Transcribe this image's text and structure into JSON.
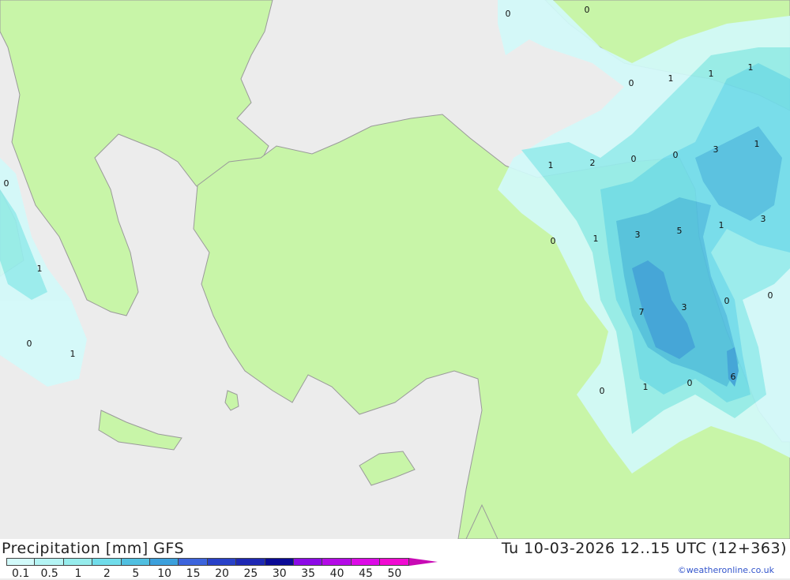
{
  "title": "Precipitation [mm] GFS",
  "valid_time": "Tu 10-03-2026 12..15 UTC (12+363)",
  "credit": "©weatheronline.co.uk",
  "colors": {
    "land": "#c8f5a8",
    "sea": "#ececec",
    "border": "#999999"
  },
  "legend": {
    "labels": [
      "0.1",
      "0.5",
      "1",
      "2",
      "5",
      "10",
      "15",
      "20",
      "25",
      "30",
      "35",
      "40",
      "45",
      "50"
    ],
    "colors": [
      "#d2fafa",
      "#b4f4f4",
      "#96ecec",
      "#70dcea",
      "#50bfe0",
      "#3ca0dc",
      "#3c64dc",
      "#2841c8",
      "#1e28b4",
      "#0a0a96",
      "#8c0ae6",
      "#b40ae6",
      "#dc0ae6",
      "#f00ad2",
      "#c80ab4"
    ]
  },
  "values": [
    {
      "text": "0"
    },
    {
      "text": "0"
    },
    {
      "text": "0"
    },
    {
      "text": "1"
    },
    {
      "text": "1"
    },
    {
      "text": "1"
    },
    {
      "text": "1"
    },
    {
      "text": "2"
    },
    {
      "text": "0"
    },
    {
      "text": "0"
    },
    {
      "text": "3"
    },
    {
      "text": "1"
    },
    {
      "text": "0"
    },
    {
      "text": "0"
    },
    {
      "text": "1"
    },
    {
      "text": "3"
    },
    {
      "text": "5"
    },
    {
      "text": "1"
    },
    {
      "text": "3"
    },
    {
      "text": "1"
    },
    {
      "text": "7"
    },
    {
      "text": "3"
    },
    {
      "text": "0"
    },
    {
      "text": "0"
    },
    {
      "text": "0"
    },
    {
      "text": "1"
    },
    {
      "text": "0"
    },
    {
      "text": "1"
    },
    {
      "text": "0"
    },
    {
      "text": "6"
    }
  ]
}
